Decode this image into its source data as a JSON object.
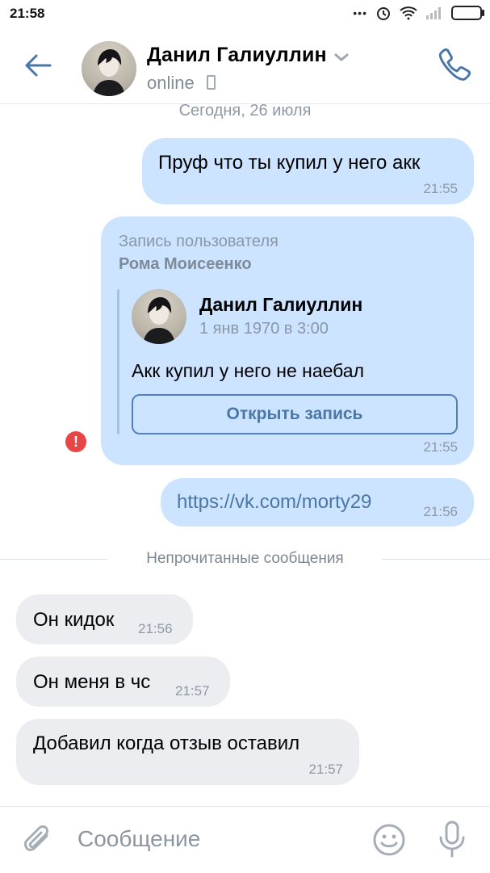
{
  "status_bar": {
    "time": "21:58"
  },
  "header": {
    "contact_name": "Данил Галиуллин",
    "status": "online"
  },
  "chat": {
    "date_separator": "Сегодня, 26 июля",
    "messages": [
      {
        "text": "Пруф что ты купил у него акк",
        "time": "21:55"
      },
      {
        "repost_label": "Запись пользователя",
        "repost_author": "Рома Моисеенко",
        "post_author": "Данил Галиуллин",
        "post_date": "1 янв 1970 в 3:00",
        "post_text": "Акк купил у него не наебал",
        "open_button": "Открыть запись",
        "time": "21:55"
      },
      {
        "text": "https://vk.com/morty29",
        "time": "21:56"
      }
    ],
    "unread_separator": "Непрочитанные сообщения",
    "incoming": [
      {
        "text": "Он кидок",
        "time": "21:56"
      },
      {
        "text": "Он меня в чс",
        "time": "21:57"
      },
      {
        "text": "Добавил когда отзыв оставил",
        "time": "21:57"
      }
    ]
  },
  "composer": {
    "placeholder": "Сообщение"
  },
  "colors": {
    "accent": "#4a76a8",
    "outgoing_bubble": "#cce4ff",
    "incoming_bubble": "#ebedf0",
    "error": "#e64646"
  },
  "icons": [
    "back-arrow-icon",
    "chevron-down-icon",
    "phone-icon",
    "paperclip-icon",
    "emoji-icon",
    "microphone-icon",
    "error-icon"
  ]
}
